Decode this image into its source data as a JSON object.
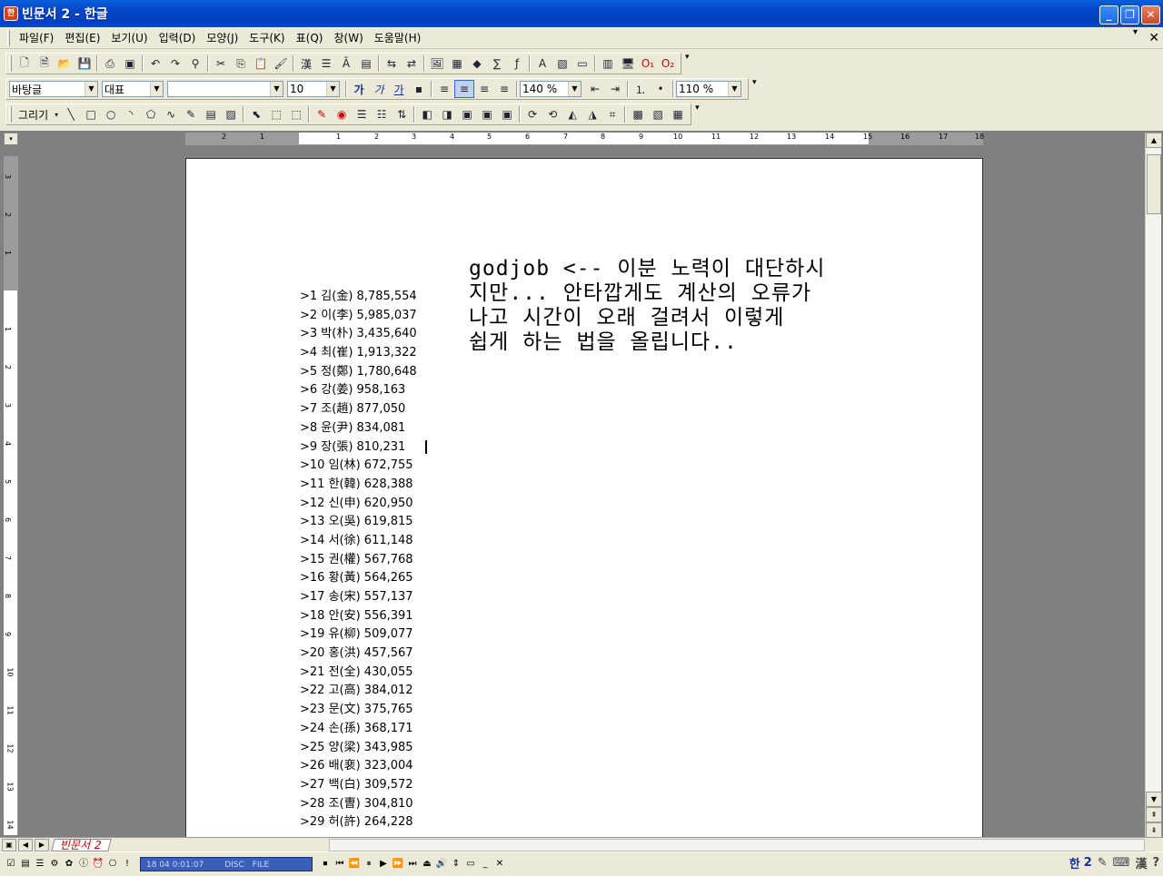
{
  "window": {
    "title": "빈문서 2 - 한글",
    "app_icon_label": "한"
  },
  "menu": [
    {
      "label": "파일(F)"
    },
    {
      "label": "편집(E)"
    },
    {
      "label": "보기(U)"
    },
    {
      "label": "입력(D)"
    },
    {
      "label": "모양(J)"
    },
    {
      "label": "도구(K)"
    },
    {
      "label": "표(Q)"
    },
    {
      "label": "창(W)"
    },
    {
      "label": "도움말(H)"
    }
  ],
  "format_bar": {
    "style": "바탕글",
    "language": "대표",
    "font": "",
    "size": "10",
    "line_spacing": "140 %",
    "zoom": "110 %",
    "bold_label": "가",
    "italic_label": "가",
    "underline_label": "가"
  },
  "draw_bar": {
    "label": "그리기"
  },
  "ruler": {
    "h_ticks": [
      "2",
      "1",
      "1",
      "2",
      "3",
      "4",
      "5",
      "6",
      "7",
      "8",
      "9",
      "10",
      "11",
      "12",
      "13",
      "14",
      "15",
      "16",
      "17",
      "18"
    ],
    "v_ticks": [
      "3",
      "2",
      "1",
      "1",
      "2",
      "3",
      "4",
      "5",
      "6",
      "7",
      "8",
      "9",
      "10",
      "11",
      "12",
      "13",
      "14"
    ]
  },
  "document": {
    "comment_lines": [
      "godjob <-- 이분 노력이 대단하시",
      "지만... 안타깝게도 계산의 오류가",
      "나고 시간이 오래 걸려서 이렇게",
      "쉽게 하는 법을 올립니다.."
    ],
    "surnames": [
      ">1 김(金) 8,785,554",
      ">2 이(李) 5,985,037",
      ">3 박(朴) 3,435,640",
      ">4 최(崔) 1,913,322",
      ">5 정(鄭) 1,780,648",
      ">6 강(姜) 958,163",
      ">7 조(趙) 877,050",
      ">8 윤(尹) 834,081",
      ">9 장(張) 810,231",
      ">10 임(林) 672,755",
      ">11 한(韓) 628,388",
      ">12 신(申) 620,950",
      ">13 오(吳) 619,815",
      ">14 서(徐) 611,148",
      ">15 권(權) 567,768",
      ">16 황(黃) 564,265",
      ">17 송(宋) 557,137",
      ">18 안(安) 556,391",
      ">19 유(柳) 509,077",
      ">20 홍(洪) 457,567",
      ">21 전(全) 430,055",
      ">22 고(高) 384,012",
      ">23 문(文) 375,765",
      ">24 손(孫) 368,171",
      ">25 양(梁) 343,985",
      ">26 배(裵) 323,004",
      ">27 백(白) 309,572",
      ">28 조(曺) 304,810",
      ">29 허(許) 264,228"
    ]
  },
  "tabs": [
    {
      "label": "빈문서 2"
    }
  ],
  "statusbar": {
    "media_text": "18 04 0:01:07",
    "disc_label": "DISC",
    "file_label": "FILE",
    "ime_label": "한"
  },
  "colors": {
    "titlebar": "#0345c8",
    "tab_text": "#c00000",
    "workspace": "#808080"
  }
}
